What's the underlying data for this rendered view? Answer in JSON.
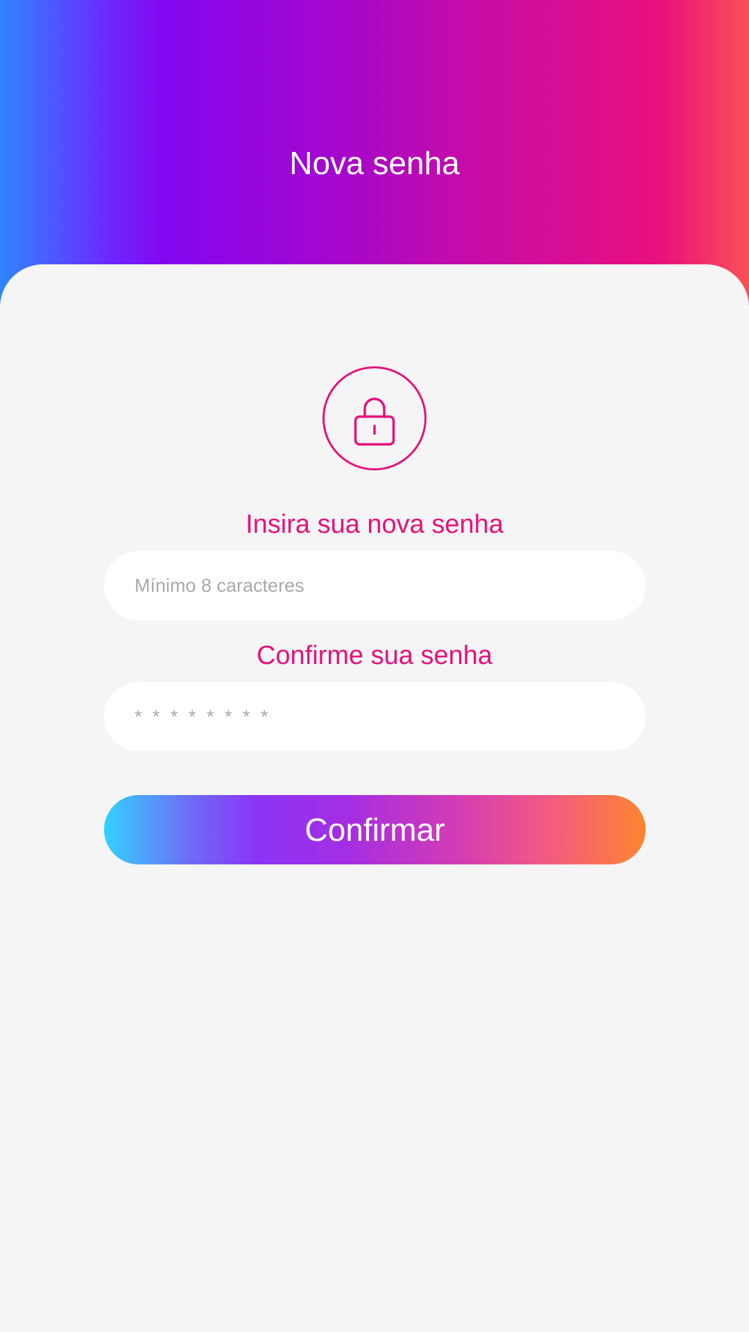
{
  "header": {
    "title": "Nova senha"
  },
  "form": {
    "lock_icon": "lock-icon",
    "new_password_label": "Insira sua nova senha",
    "new_password_placeholder": "Mínimo 8 caracteres",
    "new_password_value": "",
    "confirm_password_label": "Confirme sua senha",
    "confirm_password_placeholder": "* * * * * * * *",
    "confirm_password_value": "",
    "confirm_button_label": "Confirmar"
  },
  "colors": {
    "accent": "#e5127d",
    "background": "#f5f5f5",
    "input_background": "#ffffff",
    "header_gradient": [
      "#2f86ff",
      "#8406f0",
      "#e90f7f",
      "#fa5054"
    ],
    "button_gradient": [
      "#33d1ff",
      "#8b34f7",
      "#d33bb5",
      "#ff8530"
    ]
  }
}
